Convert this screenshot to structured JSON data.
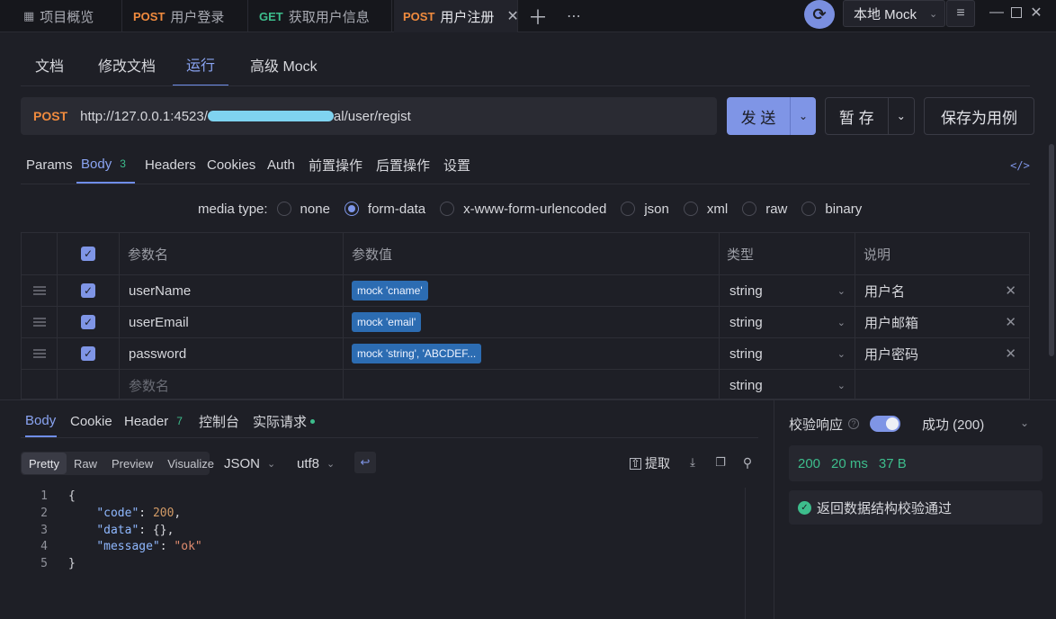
{
  "tabs": [
    {
      "method": "",
      "label": "项目概览"
    },
    {
      "method": "POST",
      "label": "用户登录"
    },
    {
      "method": "GET",
      "label": "获取用户信息"
    },
    {
      "method": "POST",
      "label": "用户注册"
    }
  ],
  "env": {
    "label": "本地 Mock"
  },
  "subtabs": [
    "文档",
    "修改文档",
    "运行",
    "高级 Mock"
  ],
  "request": {
    "method": "POST",
    "url_prefix": "http://127.0.0.1:4523/",
    "url_suffix": "al/user/regist",
    "send_label": "发 送",
    "save_label": "暂 存",
    "save_case_label": "保存为用例"
  },
  "param_tabs": [
    {
      "label": "Params"
    },
    {
      "label": "Body",
      "count": "3"
    },
    {
      "label": "Headers"
    },
    {
      "label": "Cookies"
    },
    {
      "label": "Auth"
    },
    {
      "label": "前置操作"
    },
    {
      "label": "后置操作"
    },
    {
      "label": "设置"
    }
  ],
  "media": {
    "label": "media type:",
    "options": [
      "none",
      "form-data",
      "x-www-form-urlencoded",
      "json",
      "xml",
      "raw",
      "binary"
    ],
    "selected": "form-data"
  },
  "table": {
    "headers": [
      "参数名",
      "参数值",
      "类型",
      "说明"
    ],
    "rows": [
      {
        "name": "userName",
        "value": "mock 'cname'",
        "type": "string",
        "desc": "用户名"
      },
      {
        "name": "userEmail",
        "value": "mock 'email'",
        "type": "string",
        "desc": "用户邮箱"
      },
      {
        "name": "password",
        "value": "mock 'string', 'ABCDEF...",
        "type": "string",
        "desc": "用户密码"
      }
    ],
    "empty_row": {
      "placeholder": "参数名",
      "type": "string"
    }
  },
  "response_tabs": [
    {
      "label": "Body"
    },
    {
      "label": "Cookie"
    },
    {
      "label": "Header",
      "count": "7"
    },
    {
      "label": "控制台"
    },
    {
      "label": "实际请求"
    }
  ],
  "view_modes": [
    "Pretty",
    "Raw",
    "Preview",
    "Visualize"
  ],
  "format": {
    "type": "JSON",
    "encoding": "utf8",
    "extract_label": "提取"
  },
  "code_lines": [
    {
      "n": "1",
      "text": "{"
    },
    {
      "n": "2",
      "text": "    \"code\": 200,"
    },
    {
      "n": "3",
      "text": "    \"data\": {},"
    },
    {
      "n": "4",
      "text": "    \"message\": \"ok\""
    },
    {
      "n": "5",
      "text": "}"
    }
  ],
  "validation": {
    "label": "校验响应",
    "result": "成功 (200)",
    "status": "200",
    "time": "20 ms",
    "size": "37 B",
    "message": "返回数据结构校验通过"
  },
  "colors": {
    "accent": "#7f95e6",
    "post": "#f08b3e",
    "get": "#3dbd8c",
    "success": "#3dbd8c"
  }
}
